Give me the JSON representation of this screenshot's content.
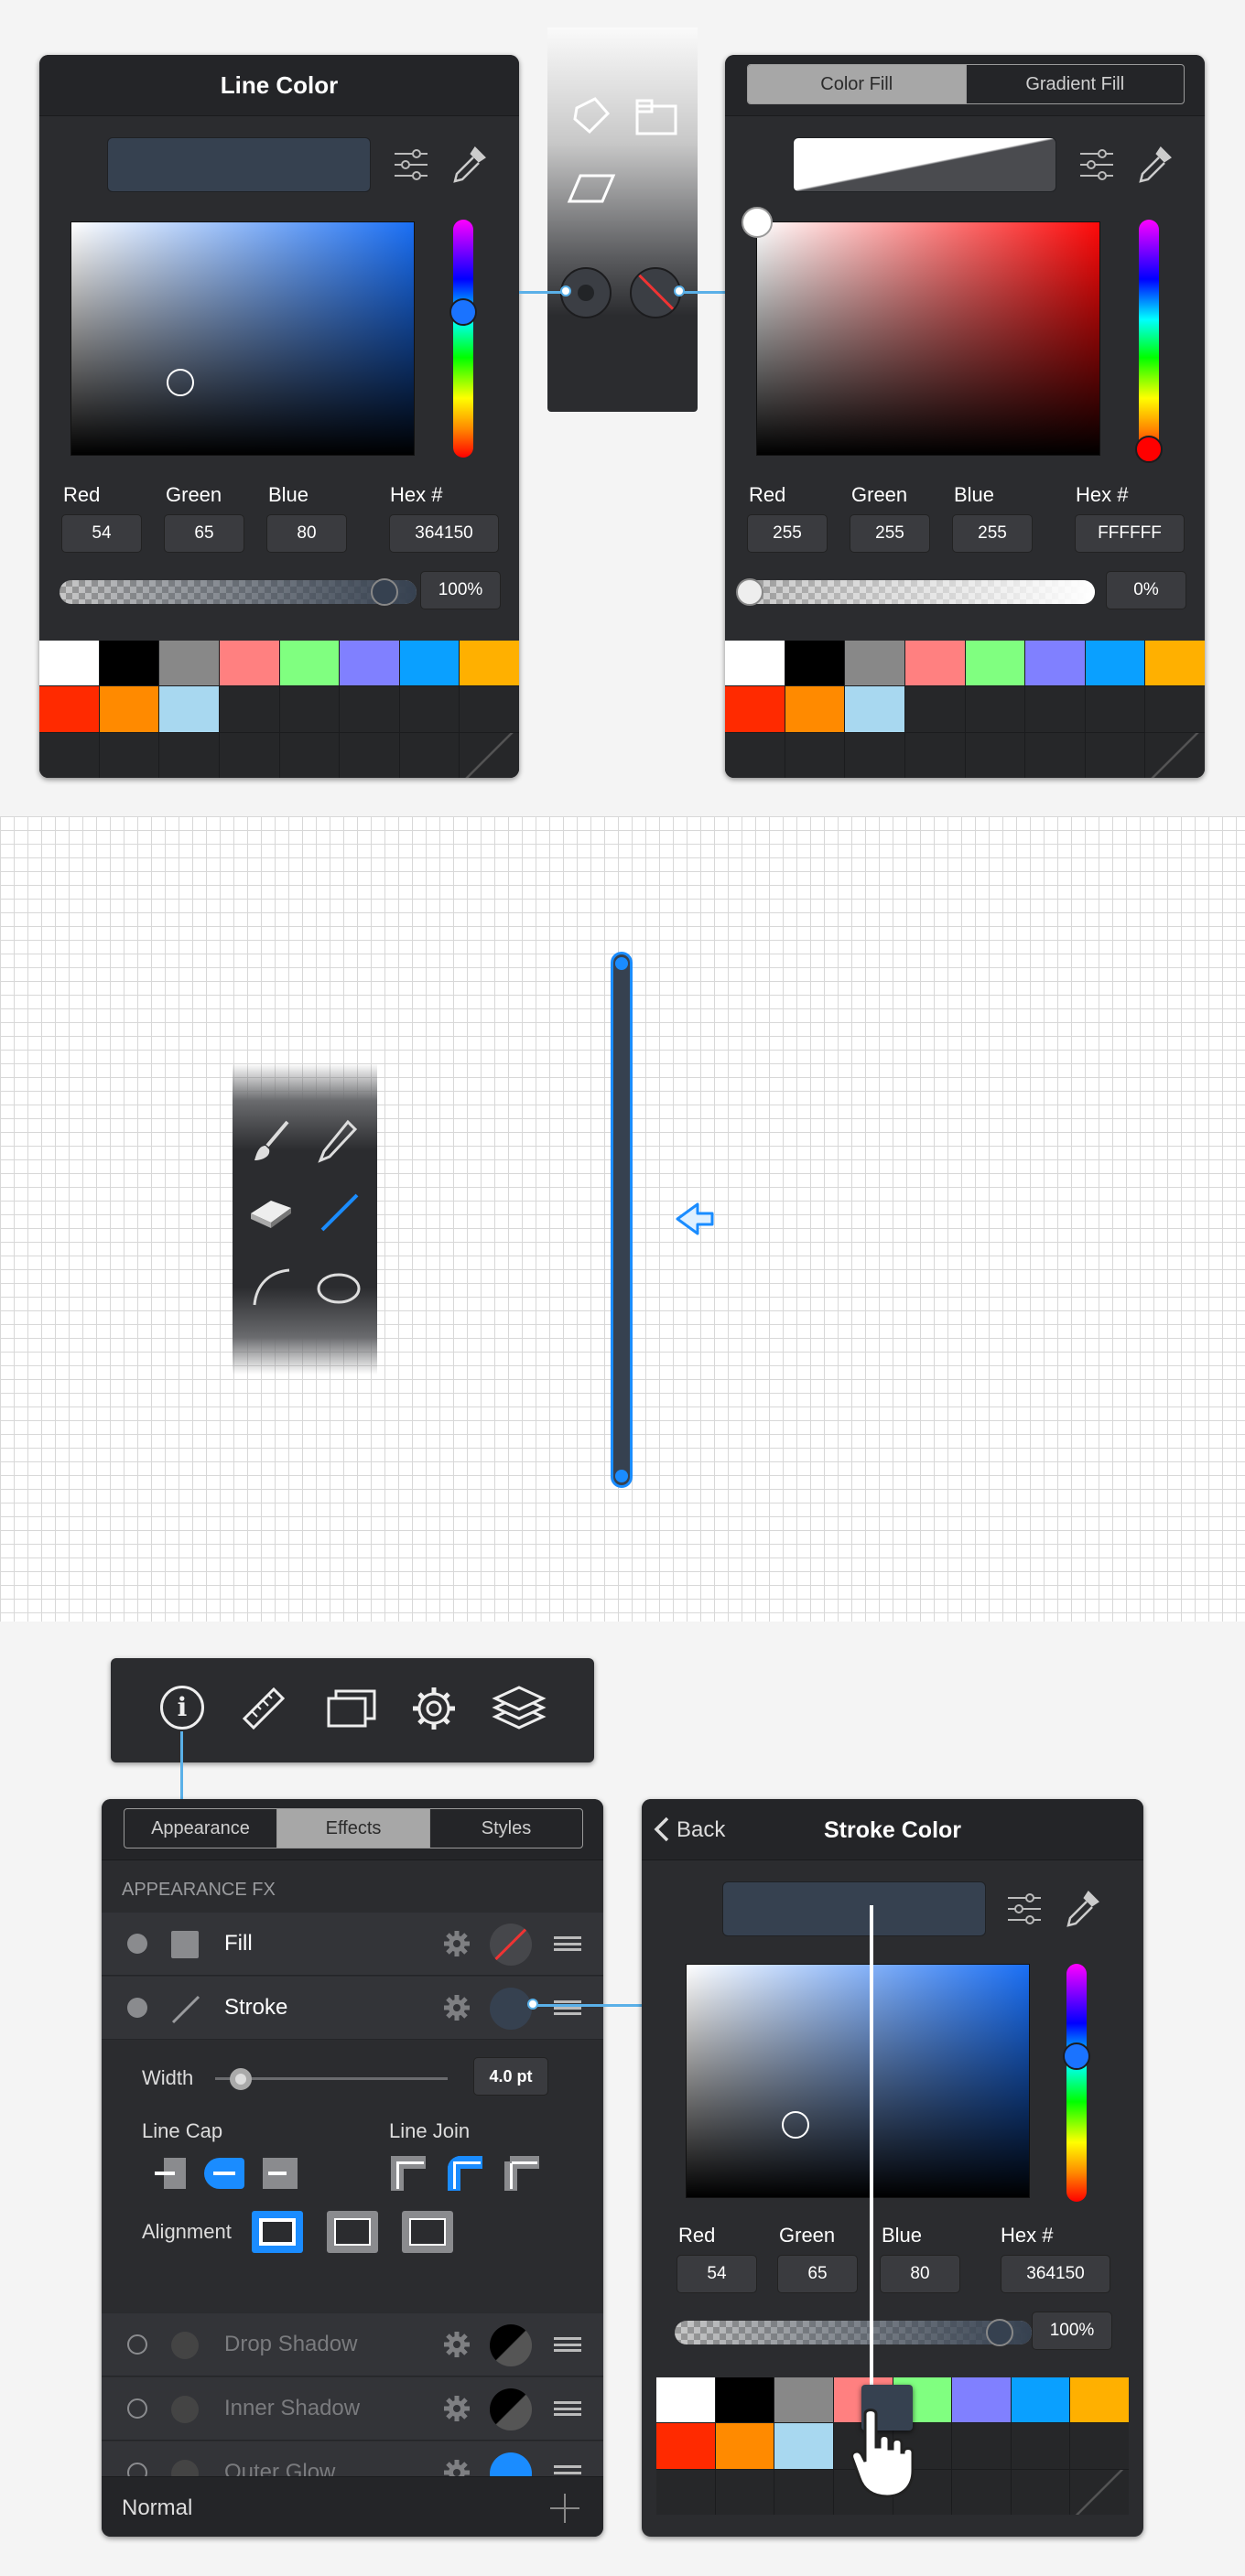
{
  "line_color_panel": {
    "title": "Line Color",
    "labels": {
      "red": "Red",
      "green": "Green",
      "blue": "Blue",
      "hex": "Hex #"
    },
    "values": {
      "red": "54",
      "green": "65",
      "blue": "80",
      "hex": "364150"
    },
    "opacity": "100%",
    "preview_color": "#364150"
  },
  "fill_panel": {
    "tabs": [
      "Color Fill",
      "Gradient Fill"
    ],
    "selected_tab": "Color Fill",
    "labels": {
      "red": "Red",
      "green": "Green",
      "blue": "Blue",
      "hex": "Hex #"
    },
    "values": {
      "red": "255",
      "green": "255",
      "blue": "255",
      "hex": "FFFFFF"
    },
    "opacity": "0%"
  },
  "swatch_colors": [
    "#ffffff",
    "#000000",
    "#888888",
    "#ff8080",
    "#80ff80",
    "#8080ff",
    "#0aa0ff",
    "#ffb000",
    "#ff2a00",
    "#ff8a00",
    "#a8d8f0"
  ],
  "tool_strip_top": {
    "icons": [
      "rotate-tool-icon",
      "rectangle-tool-icon",
      "skew-tool-icon",
      "stroke-well-icon",
      "fill-well-icon"
    ]
  },
  "tool_palette_canvas": {
    "icons": [
      "brush-icon",
      "pencil-icon",
      "eraser-icon",
      "line-icon",
      "arc-icon",
      "ellipse-icon"
    ]
  },
  "top_toolbar": {
    "icons": [
      "info-icon",
      "ruler-icon",
      "layers-stack-icon",
      "gear-icon",
      "layers-icon"
    ]
  },
  "appearance_panel": {
    "tabs": [
      "Appearance",
      "Effects",
      "Styles"
    ],
    "selected_tab": "Effects",
    "section_header": "APPEARANCE FX",
    "fill_label": "Fill",
    "stroke_label": "Stroke",
    "width_label": "Width",
    "width_value": "4.0 pt",
    "line_cap_label": "Line Cap",
    "line_join_label": "Line Join",
    "alignment_label": "Alignment",
    "effects": [
      "Drop Shadow",
      "Inner Shadow",
      "Outer Glow"
    ],
    "blend_mode": "Normal"
  },
  "stroke_color_panel": {
    "back_label": "Back",
    "title": "Stroke Color",
    "labels": {
      "red": "Red",
      "green": "Green",
      "blue": "Blue",
      "hex": "Hex #"
    },
    "values": {
      "red": "54",
      "green": "65",
      "blue": "80",
      "hex": "364150"
    },
    "opacity": "100%"
  },
  "accent_color": "#1a8cff"
}
